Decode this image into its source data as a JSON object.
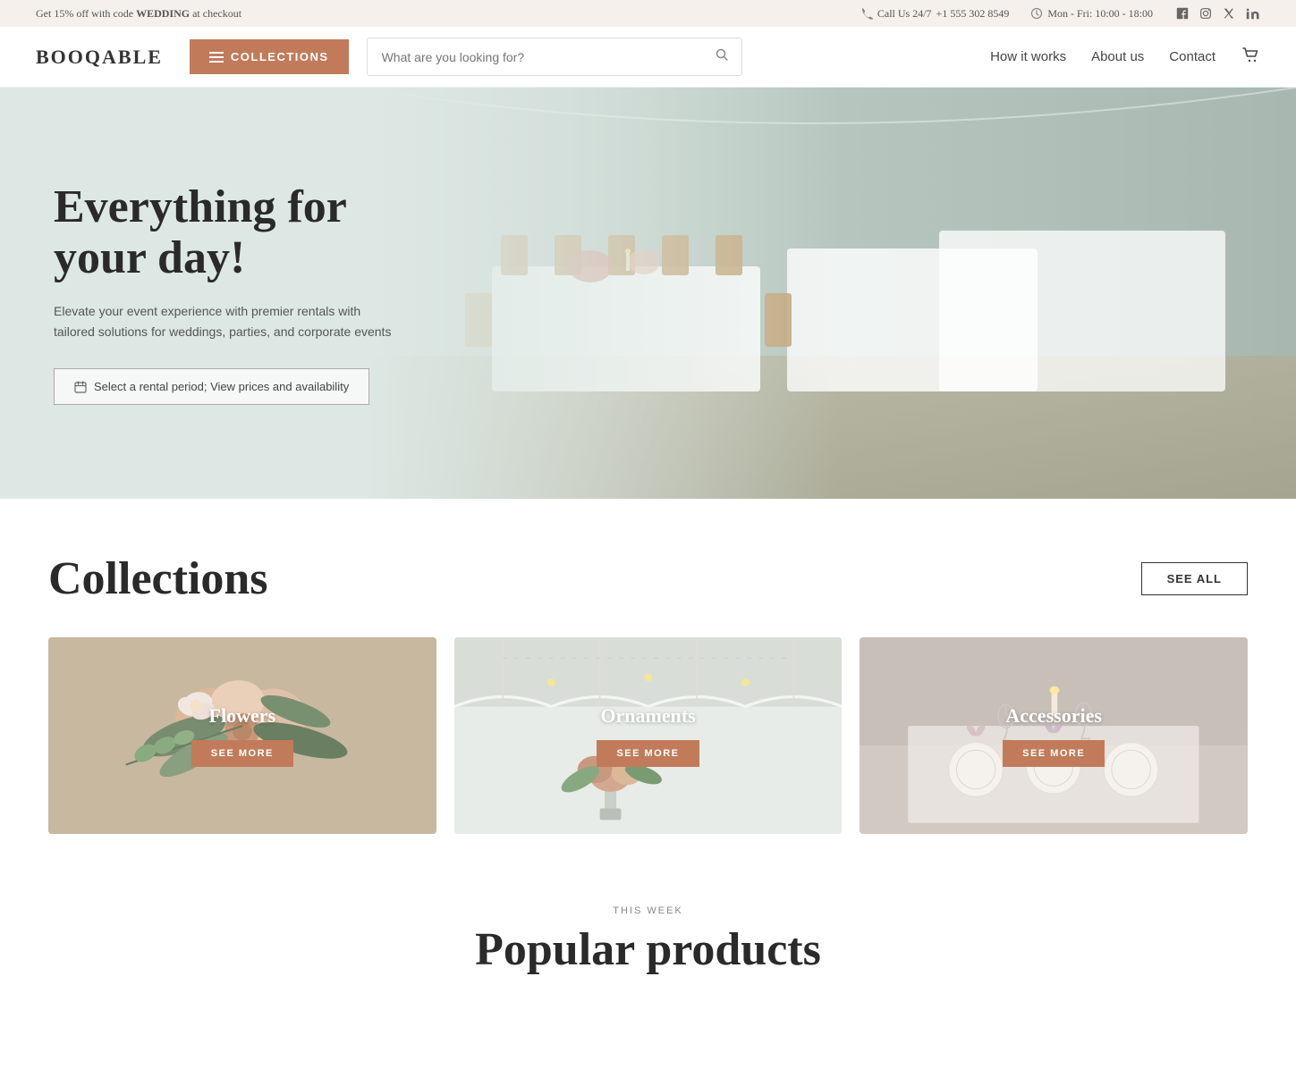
{
  "topbar": {
    "promo_text": "Get 15% off with code ",
    "promo_code": "WEDDING",
    "promo_suffix": " at checkout",
    "phone_label": "Call Us 24/7",
    "phone_number": "+1 555 302 8549",
    "hours": "Mon - Fri: 10:00 - 18:00"
  },
  "header": {
    "logo": "BOOQABLE",
    "collections_btn": "COLLECTIONS",
    "search_placeholder": "What are you looking for?",
    "nav_links": [
      {
        "label": "How it works",
        "href": "#"
      },
      {
        "label": "About us",
        "href": "#"
      },
      {
        "label": "Contact",
        "href": "#"
      }
    ]
  },
  "hero": {
    "title": "Everything for your day!",
    "subtitle": "Elevate your event experience with premier rentals with tailored solutions for weddings, parties, and corporate events",
    "cta_label": "Select a rental period; View prices and availability"
  },
  "collections_section": {
    "title": "Collections",
    "see_all_label": "SEE ALL",
    "cards": [
      {
        "name": "Flowers",
        "see_more": "SEE MORE"
      },
      {
        "name": "Ornaments",
        "see_more": "SEE MORE"
      },
      {
        "name": "Accessories",
        "see_more": "SEE MORE"
      }
    ]
  },
  "this_week": {
    "label": "THIS WEEK",
    "title": "Popular products"
  }
}
